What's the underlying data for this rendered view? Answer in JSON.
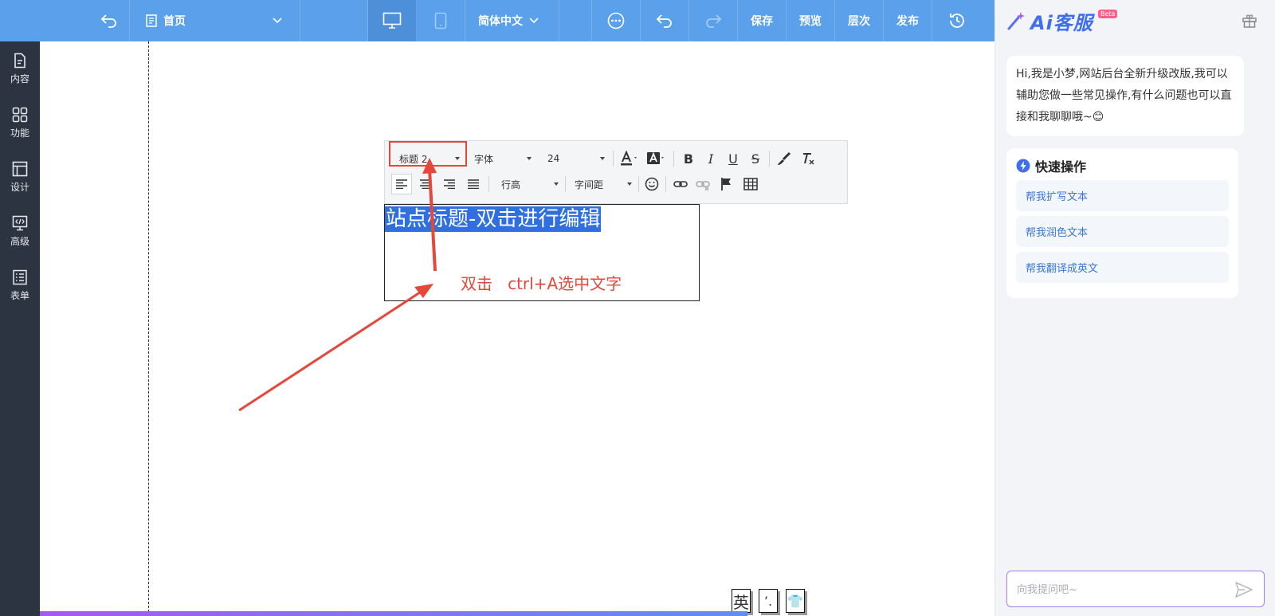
{
  "colors": {
    "toolbar": "#5aa0ea",
    "nav": "#2c3441",
    "annotation": "#e5473b",
    "selection": "#2f6fe0",
    "panel_bg": "#f2f4f8"
  },
  "topbar": {
    "page_select": "首页",
    "language_select": "简体中文",
    "save": "保存",
    "preview": "预览",
    "layers": "层次",
    "publish": "发布",
    "icons": [
      "back-icon",
      "page-icon",
      "chevron-down-icon",
      "desktop-icon",
      "mobile-icon",
      "more-icon",
      "undo-icon",
      "redo-icon",
      "history-icon"
    ]
  },
  "leftnav": {
    "items": [
      {
        "label": "内容",
        "icon": "document-icon"
      },
      {
        "label": "功能",
        "icon": "grid-icon"
      },
      {
        "label": "设计",
        "icon": "layout-icon"
      },
      {
        "label": "高级",
        "icon": "code-monitor-icon"
      },
      {
        "label": "表单",
        "icon": "form-icon"
      }
    ]
  },
  "editor": {
    "heading_select": "标题 2",
    "font_select": "字体",
    "size_select": "24",
    "line_height_select": "行高",
    "letter_spacing_select": "字间距",
    "site_title": "站点标题-双击进行编辑",
    "annotation": "双击   ctrl+A选中文字"
  },
  "ime": {
    "chars": [
      "英",
      "’.",
      "👕"
    ]
  },
  "ai_panel": {
    "logo": "Ai客服",
    "beta": "Beta",
    "greeting": "Hi,我是小梦,网站后台全新升级改版,我可以辅助您做一些常见操作,有什么问题也可以直接和我聊聊哦~😊",
    "quick_title": "快速操作",
    "quick_actions": [
      "帮我扩写文本",
      "帮我润色文本",
      "帮我翻译成英文"
    ],
    "input_placeholder": "向我提问吧~"
  }
}
